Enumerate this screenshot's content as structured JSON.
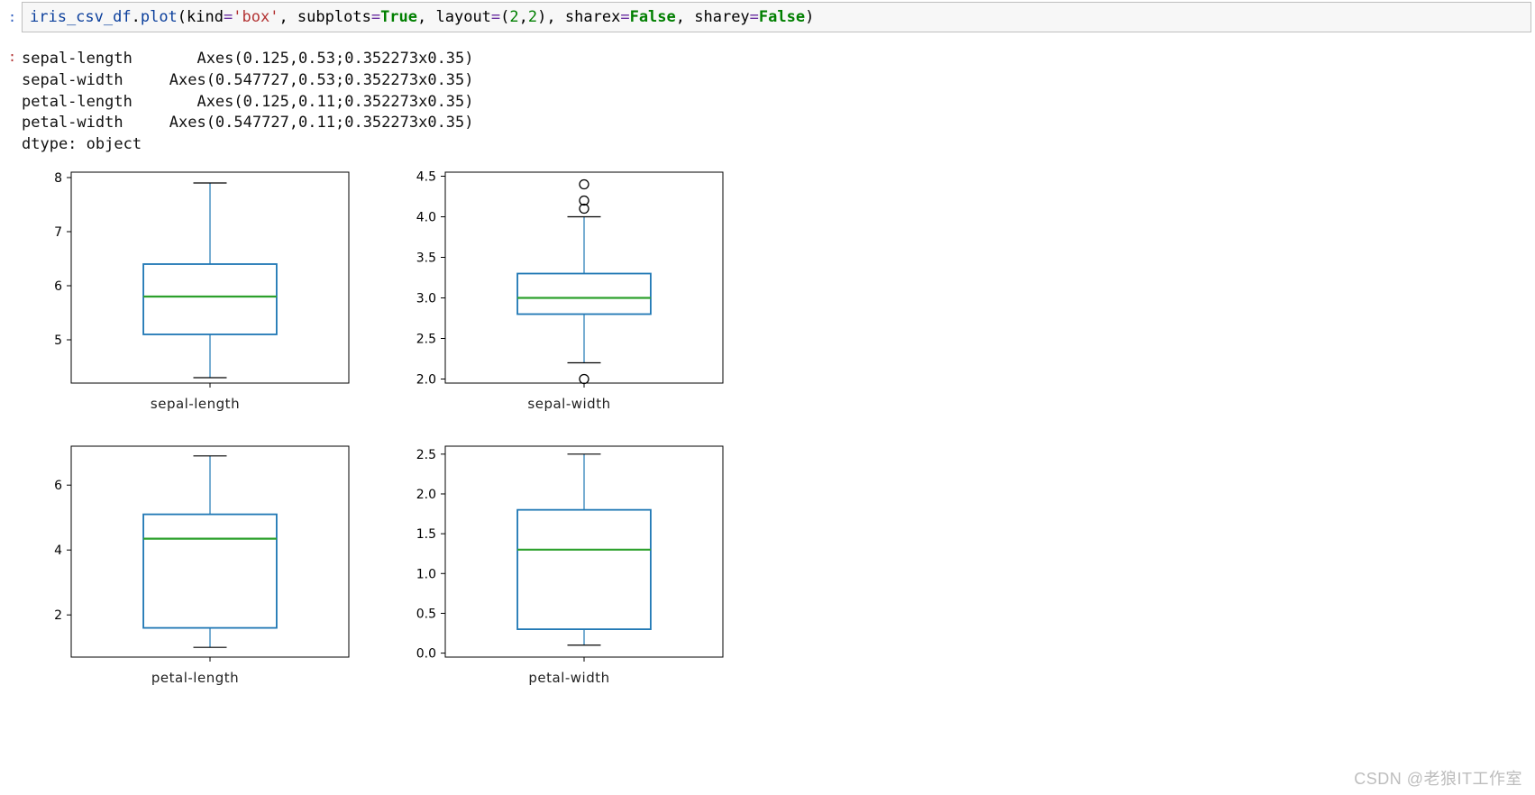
{
  "code": {
    "tokens": [
      {
        "t": "iris_csv_df",
        "c": "name"
      },
      {
        "t": ".",
        "c": "dot"
      },
      {
        "t": "plot",
        "c": "name"
      },
      {
        "t": "(",
        "c": "par"
      },
      {
        "t": "kind",
        "c": "arg"
      },
      {
        "t": "=",
        "c": "eq"
      },
      {
        "t": "'box'",
        "c": "str"
      },
      {
        "t": ", ",
        "c": "dot"
      },
      {
        "t": "subplots",
        "c": "arg"
      },
      {
        "t": "=",
        "c": "eq"
      },
      {
        "t": "True",
        "c": "kw"
      },
      {
        "t": ", ",
        "c": "dot"
      },
      {
        "t": "layout",
        "c": "arg"
      },
      {
        "t": "=",
        "c": "eq"
      },
      {
        "t": "(",
        "c": "par"
      },
      {
        "t": "2",
        "c": "num"
      },
      {
        "t": ",",
        "c": "dot"
      },
      {
        "t": "2",
        "c": "num"
      },
      {
        "t": ")",
        "c": "par"
      },
      {
        "t": ", ",
        "c": "dot"
      },
      {
        "t": "sharex",
        "c": "arg"
      },
      {
        "t": "=",
        "c": "eq"
      },
      {
        "t": "False",
        "c": "kw"
      },
      {
        "t": ", ",
        "c": "dot"
      },
      {
        "t": "sharey",
        "c": "arg"
      },
      {
        "t": "=",
        "c": "eq"
      },
      {
        "t": "False",
        "c": "kw"
      },
      {
        "t": ")",
        "c": "par"
      }
    ]
  },
  "output_text": "sepal-length       Axes(0.125,0.53;0.352273x0.35)\nsepal-width     Axes(0.547727,0.53;0.352273x0.35)\npetal-length       Axes(0.125,0.11;0.352273x0.35)\npetal-width     Axes(0.547727,0.11;0.352273x0.35)\ndtype: object",
  "watermark": "CSDN @老狼IT工作室",
  "chart_data": [
    {
      "type": "boxplot",
      "xlabel": "sepal-length",
      "yticks": [
        5,
        6,
        7,
        8
      ],
      "ymin": 4.2,
      "ymax": 8.1,
      "box": {
        "q1": 5.1,
        "median": 5.8,
        "q3": 6.4,
        "whisker_low": 4.3,
        "whisker_high": 7.9
      },
      "outliers": []
    },
    {
      "type": "boxplot",
      "xlabel": "sepal-width",
      "yticks": [
        2.0,
        2.5,
        3.0,
        3.5,
        4.0,
        4.5
      ],
      "ymin": 1.95,
      "ymax": 4.55,
      "box": {
        "q1": 2.8,
        "median": 3.0,
        "q3": 3.3,
        "whisker_low": 2.2,
        "whisker_high": 4.0
      },
      "outliers": [
        4.4,
        4.2,
        4.1,
        2.0
      ]
    },
    {
      "type": "boxplot",
      "xlabel": "petal-length",
      "yticks": [
        2,
        4,
        6
      ],
      "ymin": 0.7,
      "ymax": 7.2,
      "box": {
        "q1": 1.6,
        "median": 4.35,
        "q3": 5.1,
        "whisker_low": 1.0,
        "whisker_high": 6.9
      },
      "outliers": []
    },
    {
      "type": "boxplot",
      "xlabel": "petal-width",
      "yticks": [
        0.0,
        0.5,
        1.0,
        1.5,
        2.0,
        2.5
      ],
      "ymin": -0.05,
      "ymax": 2.6,
      "box": {
        "q1": 0.3,
        "median": 1.3,
        "q3": 1.8,
        "whisker_low": 0.1,
        "whisker_high": 2.5
      },
      "outliers": []
    }
  ]
}
